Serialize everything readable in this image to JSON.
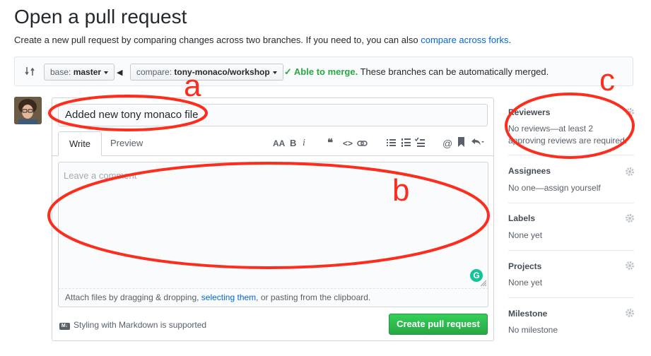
{
  "page": {
    "title": "Open a pull request",
    "subtitle_text": "Create a new pull request by comparing changes across two branches. If you need to, you can also ",
    "subtitle_link": "compare across forks",
    "subtitle_end": "."
  },
  "range": {
    "base_label": "base:",
    "base_value": "master",
    "compare_label": "compare:",
    "compare_value": "tony-monaco/workshop",
    "merge_ok": "Able to merge.",
    "merge_text": "These branches can be automatically merged."
  },
  "editor": {
    "title_value": "Added new tony monaco file",
    "tabs": [
      "Write",
      "Preview"
    ],
    "placeholder": "Leave a comment",
    "attach_prefix": "Attach files by dragging & dropping, ",
    "attach_link": "selecting them",
    "attach_suffix": ", or pasting from the clipboard.",
    "markdown_note": "Styling with Markdown is supported",
    "markdown_badge": "M↓",
    "submit": "Create pull request",
    "toolbar": {
      "header": "AA",
      "bold": "B",
      "italic": "i",
      "quote": "❝",
      "code": "<>"
    }
  },
  "sidebar": {
    "reviewers_title": "Reviewers",
    "reviewers_value": "No reviews—at least 2 approving reviews are required.",
    "assignees_title": "Assignees",
    "assignees_value": "No one—assign yourself",
    "labels_title": "Labels",
    "labels_value": "None yet",
    "projects_title": "Projects",
    "projects_value": "None yet",
    "milestone_title": "Milestone",
    "milestone_value": "No milestone"
  },
  "annotations": {
    "a": "a",
    "b": "b",
    "c": "c"
  },
  "colors": {
    "annotation": "#fc2d1c",
    "accent_green": "#28a745",
    "link": "#0366d6"
  }
}
